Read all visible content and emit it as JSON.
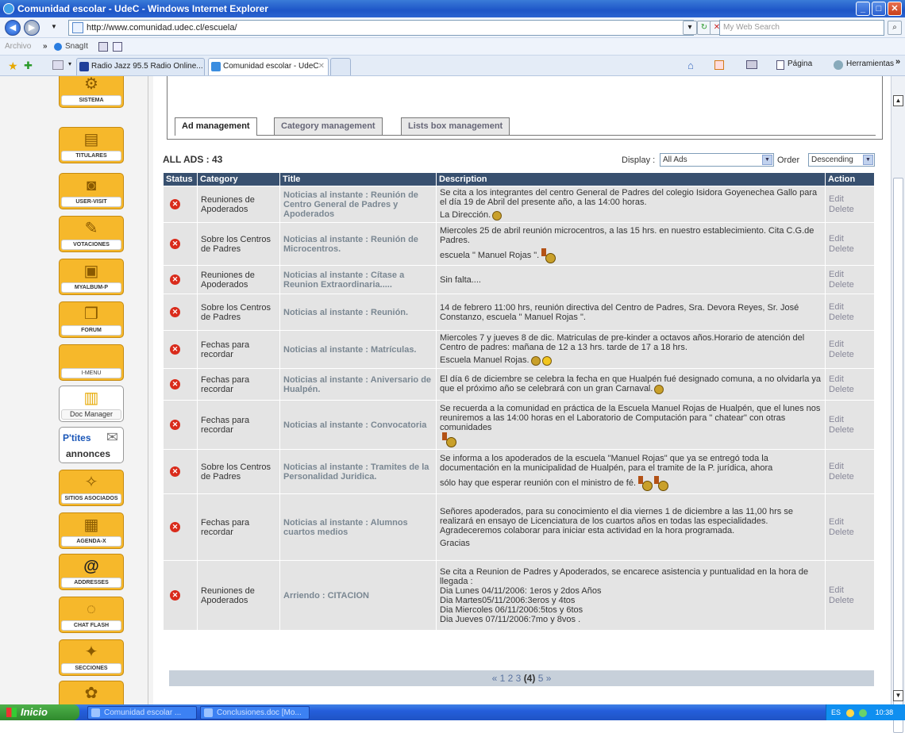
{
  "window": {
    "title": "Comunidad escolar - UdeC - Windows Internet Explorer"
  },
  "browser": {
    "url": "http://www.comunidad.udec.cl/escuela/",
    "search_placeholder": "My Web Search",
    "links": {
      "archivo": "Archivo",
      "snagit": "SnagIt"
    },
    "tabs": [
      {
        "label": "Radio Jazz 95.5 Radio Online..."
      },
      {
        "label": "Comunidad escolar - UdeC"
      }
    ],
    "toolbar": {
      "pagina": "Página",
      "herramientas": "Herramientas"
    }
  },
  "sidebar": {
    "items": [
      {
        "label": "SISTEMA",
        "icon": "gears-icon"
      },
      {
        "label": "TITULARES",
        "icon": "document-icon"
      },
      {
        "label": "USER-VISIT",
        "icon": "camera-icon"
      },
      {
        "label": "VOTACIONES",
        "icon": "ballot-icon"
      },
      {
        "label": "MYALBUM-P",
        "icon": "photo-icon"
      },
      {
        "label": "FORUM",
        "icon": "books-icon"
      },
      {
        "label": "I-MENU",
        "icon": "menu-icon"
      },
      {
        "label": "Doc Manager",
        "icon": "doc-manager-icon"
      },
      {
        "label": "annonces",
        "icon": "newspaper-icon",
        "brand": "P'tites"
      },
      {
        "label": "SITIOS ASOCIADOS",
        "icon": "globe-icon"
      },
      {
        "label": "AGENDA-X",
        "icon": "agenda-icon"
      },
      {
        "label": "ADDRESSES",
        "icon": "at-icon"
      },
      {
        "label": "CHAT FLASH",
        "icon": "chat-icon"
      },
      {
        "label": "SECCIONES",
        "icon": "sections-icon"
      }
    ]
  },
  "tabs": {
    "ad": "Ad management",
    "category": "Category management",
    "lists": "Lists box management"
  },
  "list": {
    "all_ads": "ALL ADS : 43",
    "display_label": "Display :",
    "display_value": "All Ads",
    "order_label": "Order",
    "order_value": "Descending",
    "headers": {
      "status": "Status",
      "category": "Category",
      "title": "Title",
      "description": "Description",
      "action": "Action"
    },
    "edit": "Edit",
    "delete": "Delete",
    "rows": [
      {
        "category": "Reuniones de Apoderados",
        "title": "Noticias al instante : Reunión de Centro General de Padres y Apoderados",
        "desc": [
          "Se cita a los integrantes del centro General de Padres del colegio Isidora Goyenechea Gallo para el día 19 de Abril del presente año, a las 14:00 horas.",
          "La Dirección."
        ]
      },
      {
        "category": "Sobre los Centros de Padres",
        "title": "Noticias al instante : Reunión de Microcentros.",
        "desc": [
          "Miercoles 25 de abril reunión microcentros, a las 15 hrs. en nuestro establecimiento. Cita C.G.de Padres.",
          "escuela \" Manuel Rojas \"."
        ]
      },
      {
        "category": "Reuniones de Apoderados",
        "title": "Noticias al instante : Cítase a Reunion Extraordinaria.....",
        "desc": [
          "Sin falta...."
        ]
      },
      {
        "category": "Sobre los Centros de Padres",
        "title": "Noticias al instante : Reunión.",
        "desc": [
          "14 de febrero 11:00 hrs, reunión directiva del Centro de Padres, Sra. Devora Reyes, Sr. José Constanzo, escuela \" Manuel Rojas \"."
        ]
      },
      {
        "category": "Fechas para recordar",
        "title": "Noticias al instante : Matrículas.",
        "desc": [
          "Miercoles 7 y jueves 8 de dic. Matriculas de pre-kinder a octavos años.Horario de atención del Centro de padres: mañana de 12 a 13 hrs. tarde de 17 a 18 hrs.",
          "Escuela Manuel Rojas."
        ]
      },
      {
        "category": "Fechas para recordar",
        "title": "Noticias al instante : Aniversario de Hualpén.",
        "desc": [
          "El día 6 de diciembre se celebra la fecha en que Hualpén fué designado comuna, a no olvidarla ya que el próximo año se celebrará con un gran Carnaval."
        ]
      },
      {
        "category": "Fechas para recordar",
        "title": "Noticias al instante : Convocatoria",
        "desc": [
          "Se recuerda a la comunidad en práctica de la Escuela Manuel Rojas de Hualpén, que el lunes nos reuniremos a las 14:00 horas en el Laboratorio de Computación para \" chatear\" con otras comunidades"
        ]
      },
      {
        "category": "Sobre los Centros de Padres",
        "title": "Noticias al instante : Tramites de la Personalidad Juridica.",
        "desc": [
          "Se informa a los apoderados de la escuela \"Manuel Rojas\" que ya se entregó toda la documentación en la municipalidad de Hualpén, para el tramite de la P. jurídica, ahora",
          "sólo hay que esperar reunión con el ministro de fé."
        ]
      },
      {
        "category": "Fechas para recordar",
        "title": "Noticias al instante : Alumnos cuartos medios",
        "desc": [
          "Señores apoderados, para su conocimiento el dia viernes 1 de diciembre a las 11,00 hrs se realizará en ensayo de Licenciatura de los cuartos años en todas las especialidades. Agradeceremos colaborar para iniciar esta actividad en la hora programada.",
          "Gracias"
        ]
      },
      {
        "category": "Reuniones de Apoderados",
        "title": "Arriendo : CITACION",
        "desc": [
          "Se cita a Reunion de Padres y Apoderados, se encarece asistencia y puntualidad en la hora de llegada :",
          "Dia Lunes 04/11/2006: 1eros y 2dos Años",
          "Dia Martes05/11/2006:3eros y 4tos",
          "Dia Miercoles 06/11/2006:5tos y 6tos",
          "Dia Jueves 07/11/2006:7mo y 8vos ."
        ]
      }
    ]
  },
  "pager": {
    "prev": "«",
    "p1": "1",
    "p2": "2",
    "p3": "3",
    "current": "(4)",
    "p5": "5",
    "next": "»"
  },
  "taskbar": {
    "start": "Inicio",
    "task1": "Comunidad escolar ...",
    "task2": "Conclusiones.doc [Mo...",
    "lang": "ES",
    "time": "10:38"
  }
}
